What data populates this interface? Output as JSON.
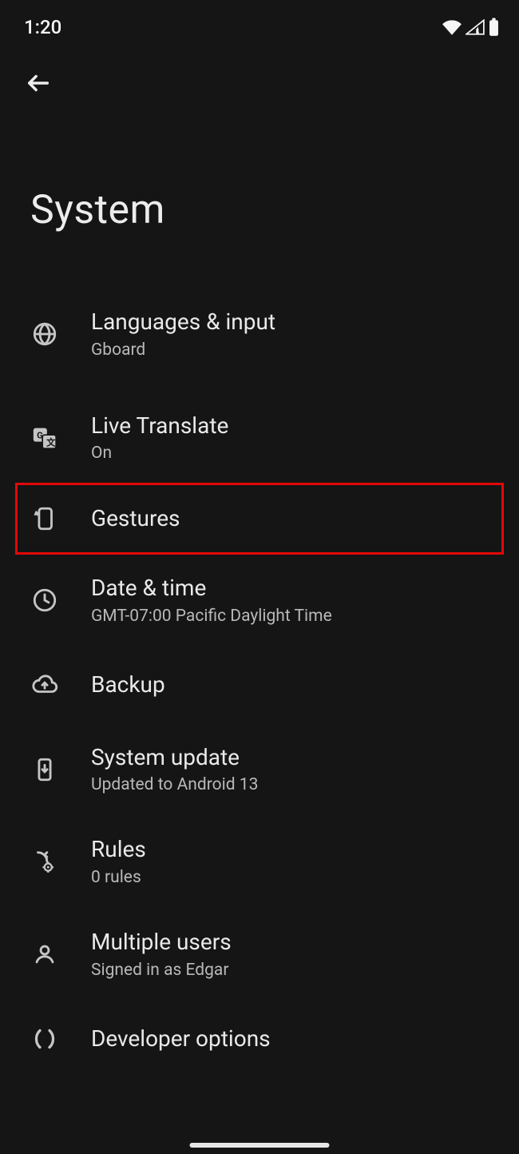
{
  "status": {
    "time": "1:20"
  },
  "header": {
    "title": "System"
  },
  "list": {
    "items": [
      {
        "icon": "globe-icon",
        "title": "Languages & input",
        "sub": "Gboard"
      },
      {
        "icon": "translate-icon",
        "title": "Live Translate",
        "sub": "On"
      },
      {
        "icon": "gesture-icon",
        "title": "Gestures",
        "sub": "",
        "highlight": true
      },
      {
        "icon": "clock-icon",
        "title": "Date & time",
        "sub": "GMT-07:00 Pacific Daylight Time"
      },
      {
        "icon": "backup-icon",
        "title": "Backup",
        "sub": ""
      },
      {
        "icon": "update-icon",
        "title": "System update",
        "sub": "Updated to Android 13"
      },
      {
        "icon": "rules-icon",
        "title": "Rules",
        "sub": "0 rules"
      },
      {
        "icon": "users-icon",
        "title": "Multiple users",
        "sub": "Signed in as Edgar"
      },
      {
        "icon": "developer-icon",
        "title": "Developer options",
        "sub": ""
      }
    ]
  }
}
